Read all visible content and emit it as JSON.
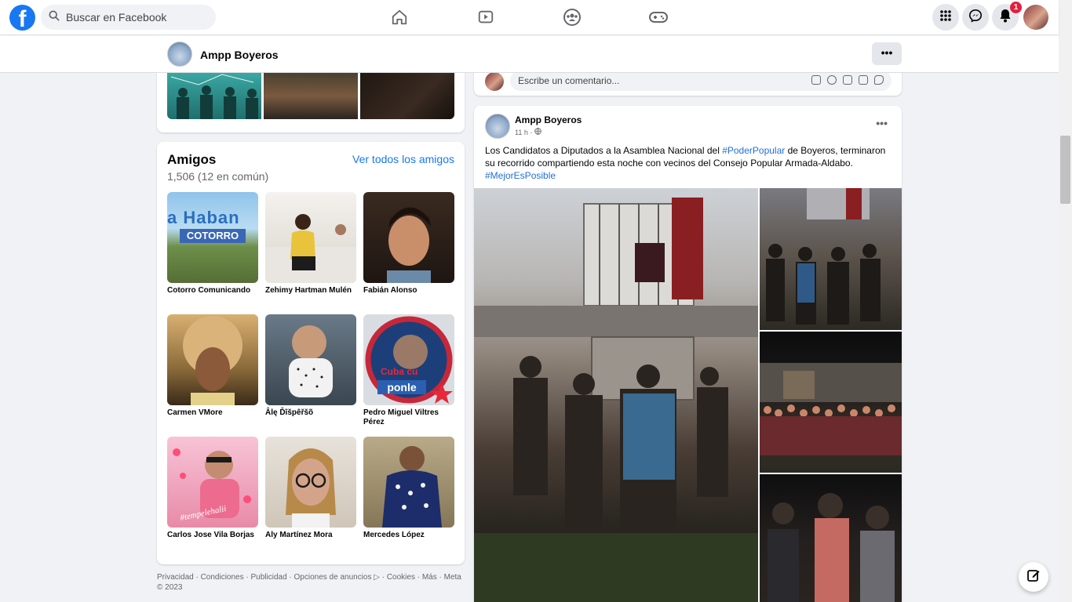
{
  "header": {
    "logo_letter": "f",
    "search_placeholder": "Buscar en Facebook",
    "nav_icons": [
      "home-icon",
      "watch-icon",
      "groups-icon",
      "gaming-icon"
    ],
    "notifications_badge": "1"
  },
  "page_bar": {
    "name": "Ampp Boyeros",
    "more_label": "•••"
  },
  "friends": {
    "title": "Amigos",
    "count": "1,506 (12 en común)",
    "see_all": "Ver todos los amigos",
    "items": [
      {
        "name": "Cotorro Comunicando",
        "overlay": "COTORRO",
        "overlay2": "a Haban"
      },
      {
        "name": "Zehimy Hartman Mulén"
      },
      {
        "name": "Fabián Alonso"
      },
      {
        "name": "Carmen VMore"
      },
      {
        "name": "Âlę Ďîšpêřšõ"
      },
      {
        "name": "Pedro Miguel Viltres Pérez",
        "overlay": "ponle",
        "overlay2": "Cuba cu"
      },
      {
        "name": "Carlos Jose Vila Borjas",
        "overlay": "#tempelehalii"
      },
      {
        "name": "Aly Martínez Mora"
      },
      {
        "name": "Mercedes López"
      }
    ]
  },
  "footer": {
    "text": "Privacidad · Condiciones · Publicidad · Opciones de anuncios ▷ · Cookies · Más · Meta © 2023"
  },
  "comment_box": {
    "placeholder": "Escribe un comentario..."
  },
  "post": {
    "author": "Ampp Boyeros",
    "time": "11 h ·",
    "more_label": "•••",
    "text_1": "Los Candidatos a Diputados a la Asamblea Nacional del ",
    "hashtag_1": "#PoderPopular",
    "text_2": " de Boyeros,  terminaron su recorrido compartiendo esta noche con vecinos del Consejo Popular Armada-Aldabo.",
    "hashtag_2": "#MejorEsPosible"
  }
}
